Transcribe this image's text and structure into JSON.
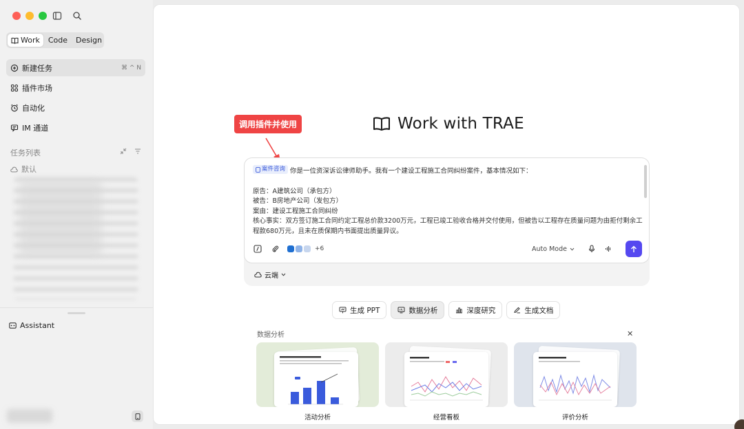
{
  "sidebar": {
    "modes": [
      {
        "label": "Work",
        "active": true
      },
      {
        "label": "Code",
        "active": false
      },
      {
        "label": "Design",
        "active": false
      }
    ],
    "nav": [
      {
        "label": "新建任务",
        "shortcut": "⌘ ^ N",
        "icon": "new-task-icon"
      },
      {
        "label": "插件市场",
        "icon": "plugins-icon"
      },
      {
        "label": "自动化",
        "icon": "alarm-icon"
      },
      {
        "label": "IM 通道",
        "icon": "message-icon"
      }
    ],
    "task_list_title": "任务列表",
    "default_group": "默认",
    "assistant_label": "Assistant"
  },
  "main": {
    "title": "Work with TRAE",
    "callout": "调用插件并使用",
    "composer": {
      "tag": "案件咨询",
      "intro": "你是一位资深诉讼律师助手。我有一个建设工程施工合同纠纷案件，基本情况如下：",
      "lines": [
        "原告：A建筑公司（承包方）",
        "被告：B房地产公司（发包方）",
        "案由：建设工程施工合同纠纷",
        "核心事实：双方签订施工合同约定工程总价款3200万元，工程已竣工验收合格并交付使用，但被告以工程存在质量问题为由拒付剩余工程款680万元，且未在质保期内书面提出质量异议。"
      ],
      "plugin_more": "+6",
      "mode_label": "Auto Mode"
    },
    "env_label": "云端",
    "chips": [
      {
        "label": "生成 PPT",
        "active": false
      },
      {
        "label": "数据分析",
        "active": true
      },
      {
        "label": "深度研究",
        "active": false
      },
      {
        "label": "生成文档",
        "active": false
      }
    ],
    "section_title": "数据分析",
    "cards": [
      {
        "label": "活动分析"
      },
      {
        "label": "经营看板"
      },
      {
        "label": "评价分析"
      }
    ]
  },
  "colors": {
    "accent": "#5548f0",
    "callout": "#ef4444",
    "traffic_red": "#fe5f57",
    "traffic_yellow": "#febc2e",
    "traffic_green": "#28c840"
  }
}
